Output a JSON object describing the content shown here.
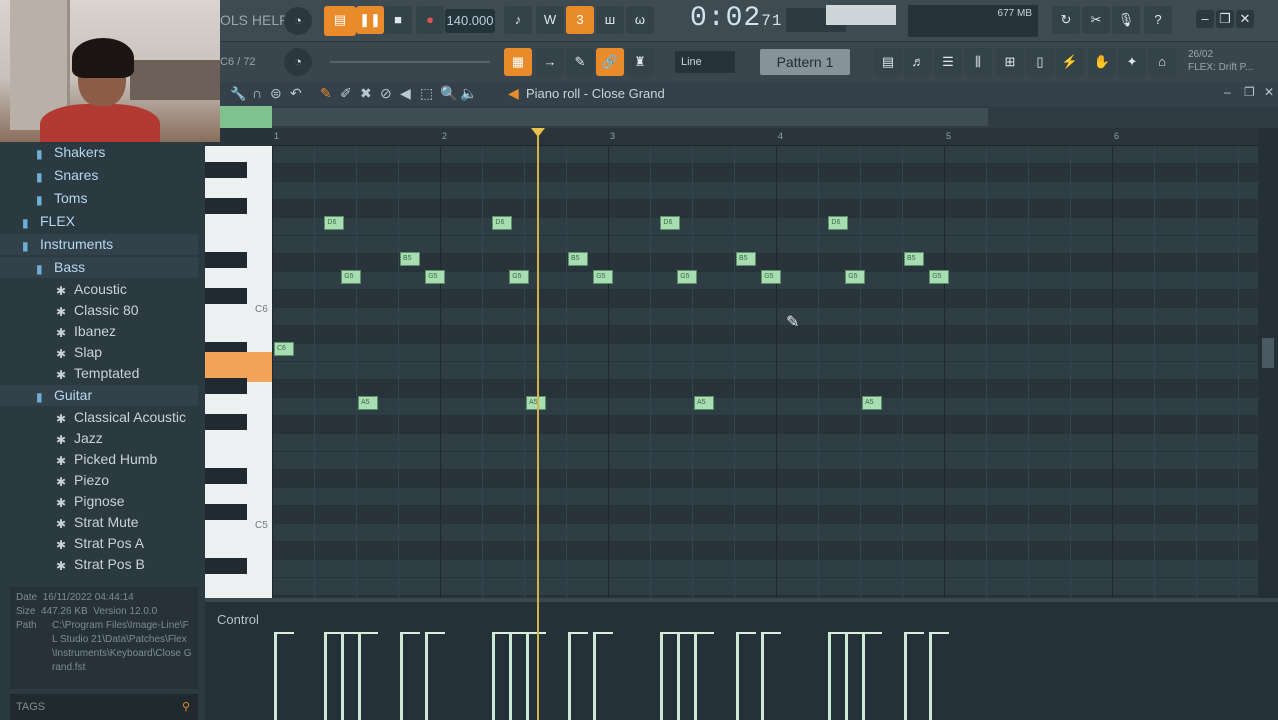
{
  "toolbar": {
    "menu_tools": "OLS HELP",
    "bpm": "140.000",
    "time": "0:02",
    "time_sub": "71",
    "pattern": "Pattern 1",
    "line_mode": "Line",
    "pos_readout": "C6 / 72",
    "cpu_mem": "677 MB",
    "hint_top": "26/02",
    "hint_bottom": "FLEX: Drift P..."
  },
  "piano_roll": {
    "title": "Piano roll - Close Grand",
    "bars": [
      "1",
      "2",
      "3",
      "4",
      "5",
      "6"
    ],
    "key_labels": [
      "C6",
      "C5"
    ],
    "control_label": "Control"
  },
  "browser": {
    "items": [
      {
        "label": "Shakers",
        "kind": "folder"
      },
      {
        "label": "Snares",
        "kind": "folder"
      },
      {
        "label": "Toms",
        "kind": "folder"
      },
      {
        "label": "FLEX",
        "kind": "folder"
      },
      {
        "label": "Instruments",
        "kind": "folder"
      },
      {
        "label": "Bass",
        "kind": "folder"
      },
      {
        "label": "Acoustic",
        "kind": "patch"
      },
      {
        "label": "Classic 80",
        "kind": "patch"
      },
      {
        "label": "Ibanez",
        "kind": "patch"
      },
      {
        "label": "Slap",
        "kind": "patch"
      },
      {
        "label": "Temptated",
        "kind": "patch"
      },
      {
        "label": "Guitar",
        "kind": "folder"
      },
      {
        "label": "Classical Acoustic",
        "kind": "patch"
      },
      {
        "label": "Jazz",
        "kind": "patch"
      },
      {
        "label": "Picked Humb",
        "kind": "patch"
      },
      {
        "label": "Piezo",
        "kind": "patch"
      },
      {
        "label": "Pignose",
        "kind": "patch"
      },
      {
        "label": "Strat Mute",
        "kind": "patch"
      },
      {
        "label": "Strat Pos A",
        "kind": "patch"
      },
      {
        "label": "Strat Pos B",
        "kind": "patch"
      }
    ],
    "info": {
      "date_label": "Date",
      "date": "16/11/2022 04:44:14",
      "size_label": "Size",
      "size": "447.26 KB",
      "version_label": "Version",
      "version": "12.0.0",
      "path_label": "Path",
      "path": "C:\\Program Files\\Image-Line\\FL Studio 21\\Data\\Patches\\Flex\\Instruments\\Keyboard\\Close Grand.fst"
    },
    "tags_label": "TAGS"
  },
  "notes": [
    {
      "label": "D6",
      "start": 0.3,
      "row": 2
    },
    {
      "label": "D6",
      "start": 1.3,
      "row": 2
    },
    {
      "label": "D6",
      "start": 2.3,
      "row": 2
    },
    {
      "label": "D6",
      "start": 3.3,
      "row": 2
    },
    {
      "label": "B5",
      "start": 0.75,
      "row": 4
    },
    {
      "label": "B5",
      "start": 1.75,
      "row": 4
    },
    {
      "label": "B5",
      "start": 2.75,
      "row": 4
    },
    {
      "label": "B5",
      "start": 3.75,
      "row": 4
    },
    {
      "label": "G5",
      "start": 0.4,
      "row": 5
    },
    {
      "label": "G5",
      "start": 0.9,
      "row": 5
    },
    {
      "label": "G5",
      "start": 1.4,
      "row": 5
    },
    {
      "label": "G5",
      "start": 1.9,
      "row": 5
    },
    {
      "label": "G5",
      "start": 2.4,
      "row": 5
    },
    {
      "label": "G5",
      "start": 2.9,
      "row": 5
    },
    {
      "label": "G5",
      "start": 3.4,
      "row": 5
    },
    {
      "label": "G5",
      "start": 3.9,
      "row": 5
    },
    {
      "label": "C6",
      "start": 0.0,
      "row": 9
    },
    {
      "label": "A5",
      "start": 0.5,
      "row": 12
    },
    {
      "label": "A5",
      "start": 1.5,
      "row": 12
    },
    {
      "label": "A5",
      "start": 2.5,
      "row": 12
    },
    {
      "label": "A5",
      "start": 3.5,
      "row": 12
    }
  ]
}
